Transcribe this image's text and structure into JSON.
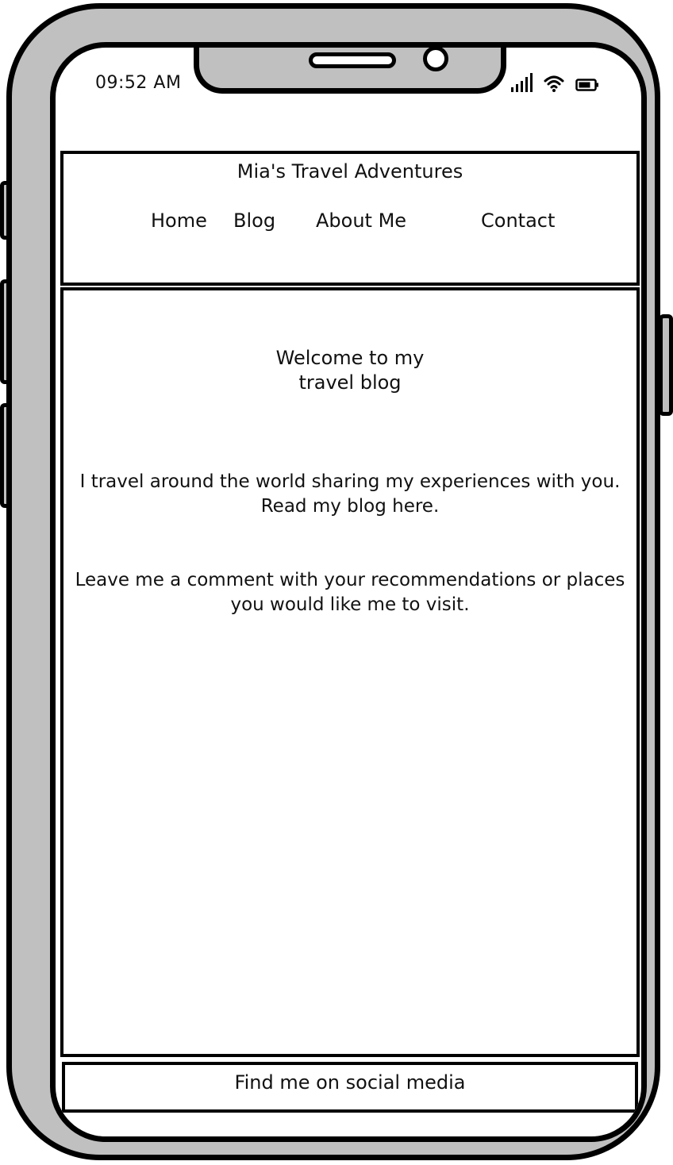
{
  "status_bar": {
    "time": "09:52 AM",
    "icons": [
      "signal-icon",
      "wifi-icon",
      "battery-icon"
    ]
  },
  "header": {
    "site_title": "Mia's Travel Adventures",
    "nav": {
      "home": "Home",
      "blog": "Blog",
      "about": "About Me",
      "contact": "Contact"
    }
  },
  "main": {
    "welcome_line1": "Welcome to my",
    "welcome_line2": "travel blog",
    "intro_line1": "I travel around the world sharing my experiences with you.",
    "intro_line2": "Read my blog here.",
    "comment_line1": "Leave me a comment with your recommendations or places",
    "comment_line2": "you would like me to visit."
  },
  "footer": {
    "social_text": "Find me on social media"
  },
  "colors": {
    "phone_body": "#c0c0c0",
    "outline": "#000000",
    "screen": "#ffffff"
  }
}
